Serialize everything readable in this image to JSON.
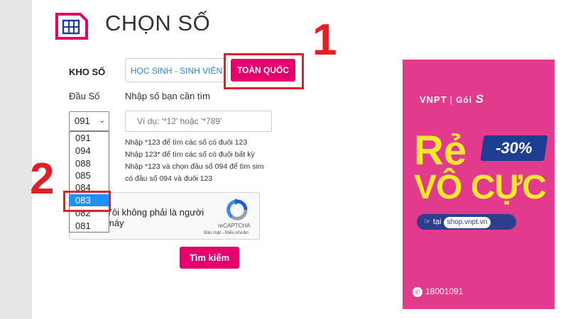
{
  "header": {
    "title": "CHỌN SỐ"
  },
  "kho_so": {
    "label": "KHO SỐ",
    "tabs": [
      {
        "label": "HỌC SINH - SINH VIÊN"
      },
      {
        "label": "TOÀN QUỐC"
      }
    ]
  },
  "dau_so": {
    "label": "Đầu Số",
    "selected": "091",
    "options": [
      "091",
      "094",
      "088",
      "085",
      "084",
      "083",
      "082",
      "081"
    ],
    "highlighted": "083"
  },
  "search": {
    "label": "Nhập số bạn cần tìm",
    "placeholder": "Ví dụ: '*12' hoặc '*789'",
    "hints": [
      "Nhập *123 để tìm các số có đuôi 123",
      "Nhập 123* để tìm các số có đuôi bất kỳ",
      "Nhập *123 và chọn đầu số 094 để tìm sim",
      "có đầu số 094 và đuôi 123"
    ],
    "button_label": "Tìm kiếm"
  },
  "captcha": {
    "text": "Tôi không phải là người máy",
    "brand": "reCAPTCHA",
    "links": "Bảo mật - Điều khoản"
  },
  "annotations": {
    "step1": "1",
    "step2": "2"
  },
  "ad": {
    "brand": "VNPT",
    "goi": "Gói",
    "goi_letter": "S",
    "headline1": "Rẻ",
    "headline2": "VÔ CỰC",
    "discount": "-30%",
    "shop_prefix": "tại",
    "shop": "shop.vnpt.vn",
    "phone": "18001091"
  },
  "colors": {
    "brand_pink": "#e5006e",
    "annotation_red": "#e41e26",
    "ad_bg": "#e23b8e",
    "ad_yellow": "#f3ea2d",
    "select_blue": "#1e90ff"
  }
}
